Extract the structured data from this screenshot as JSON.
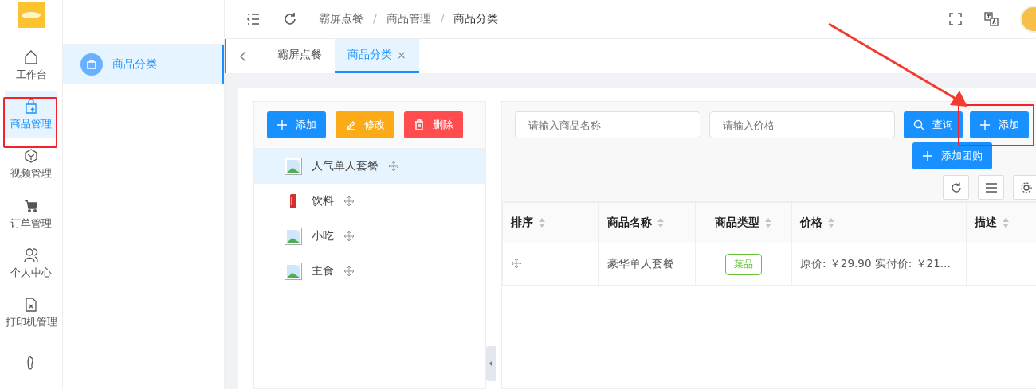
{
  "breadcrumb": [
    {
      "label": "霸屏点餐"
    },
    {
      "separator": "/",
      "label": "商品管理"
    },
    {
      "separator": "/",
      "label": "商品分类"
    }
  ],
  "rail": [
    {
      "label": "工作台",
      "selected": false
    },
    {
      "label": "商品管理",
      "selected": true
    },
    {
      "label": "视频管理",
      "selected": false
    },
    {
      "label": "订单管理",
      "selected": false
    },
    {
      "label": "个人中心",
      "selected": false
    },
    {
      "label": "打印机管理",
      "selected": false
    },
    {
      "selected": false
    }
  ],
  "submenu": [
    {
      "label": "商品分类",
      "selected": true
    }
  ],
  "tabs": [
    {
      "label": "霸屏点餐",
      "selected": false
    },
    {
      "label": "商品分类",
      "selected": true,
      "close": "×"
    }
  ],
  "category_actions": [
    {
      "label": "添加",
      "kind": "add"
    },
    {
      "label": "修改",
      "kind": "edit"
    },
    {
      "label": "删除",
      "kind": "delete"
    }
  ],
  "categories": [
    {
      "name": "人气单人套餐",
      "kind": "image",
      "selected": true
    },
    {
      "name": "饮料",
      "kind": "drink",
      "selected": false
    },
    {
      "name": "小吃",
      "kind": "image",
      "selected": false
    },
    {
      "name": "主食",
      "kind": "image",
      "selected": false
    }
  ],
  "search": {
    "name_placeholder": "请输入商品名称",
    "price_placeholder": "请输入价格",
    "query_button": "查询",
    "add_button": "添加",
    "group_buy_button": "添加团购"
  },
  "table": {
    "columns": [
      "排序",
      "商品名称",
      "商品类型",
      "价格",
      "描述"
    ],
    "rows": [
      {
        "name": "豪华单人套餐",
        "type": {
          "label": "菜品",
          "color": "#67c23a"
        },
        "price": "原价: ￥29.90 实付价: ￥21..."
      }
    ]
  }
}
